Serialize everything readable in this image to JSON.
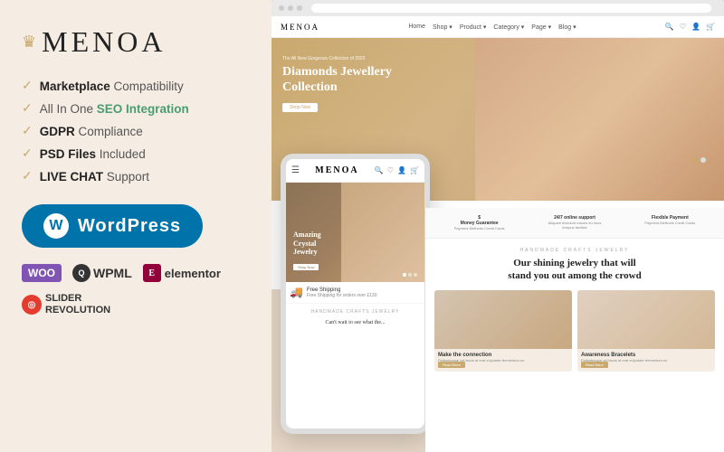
{
  "brand": {
    "name": "MENOA",
    "crown": "♛"
  },
  "features": [
    {
      "id": "marketplace",
      "text_plain": "Marketplace ",
      "highlight": "Compatibility",
      "color": "plain"
    },
    {
      "id": "seo",
      "text_plain": "All In One ",
      "highlight": "SEO Integration",
      "color": "green"
    },
    {
      "id": "gdpr",
      "text_plain": "GDPR ",
      "highlight": "Compliance",
      "color": "plain"
    },
    {
      "id": "psd",
      "text_plain": "PSD Files ",
      "highlight": "Included",
      "color": "plain"
    },
    {
      "id": "chat",
      "text_plain": "LIVE CHAT ",
      "highlight": "Support",
      "color": "plain"
    }
  ],
  "wordpress_label": "WordPress",
  "partners": {
    "woo": "WOO",
    "wpml": "WPML",
    "elementor": "elementor",
    "slider": "SLIDER\nREVOLUTION"
  },
  "hero": {
    "small_text": "The All New Gorgeous Collection of 2022",
    "title": "Diamonds Jewellery\nCollection",
    "btn": "Shop Now"
  },
  "mobile_hero": {
    "title": "Amazing\nCrystal\nJewelry",
    "btn": "Shop Now"
  },
  "shipping": {
    "title": "Free Shipping",
    "subtitle": "Free Shipping for orders over £130"
  },
  "desktop_features": [
    {
      "title": "S",
      "desc": "Money Guarantee"
    },
    {
      "title": "24/7 online support",
      "desc": "Aliquam tincidunt mauris"
    },
    {
      "title": "Flexible Payment",
      "desc": "Payment Methods Credit Cards"
    }
  ],
  "main_section": {
    "label": "HANDMADE CRAFTS JEWELRY",
    "title": "Our shining jewelry that will\nstand you out among the crowd"
  },
  "product_cards": [
    {
      "title": "Make the connection",
      "desc": "Pellentesque vel lacus at erat\nvulputate fermentum eu"
    },
    {
      "title": "Awareness Bracelets",
      "desc": "Pellentesque vel lacus at erat\nvulputate fermentum eu"
    }
  ]
}
